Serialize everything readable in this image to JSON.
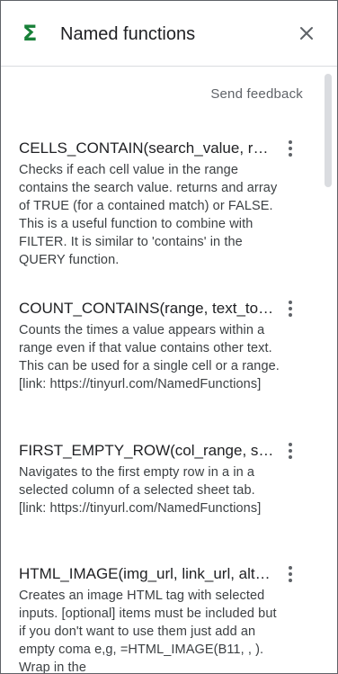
{
  "panel": {
    "title": "Named functions",
    "icon": "sigma-icon",
    "accent_color": "#188038"
  },
  "feedback_label": "Send feedback",
  "functions": [
    {
      "name": "CELLS_CONTAIN(search_value, range)",
      "description": "Checks if each cell value in the range contains the search value. returns and array of TRUE (for a contained match) or FALSE. This is a useful function to combine with FILTER. It is similar to 'contains' in the QUERY function."
    },
    {
      "name": "COUNT_CONTAINS(range, text_to_find)",
      "description": "Counts the times a value appears within a range even if that value contains other text. This can be used for a single cell or a range. [link: https://tinyurl.com/NamedFunctions]"
    },
    {
      "name": "FIRST_EMPTY_ROW(col_range, sheet)",
      "description": "Navigates to the first empty row in a in a selected column of a selected sheet tab. [link: https://tinyurl.com/NamedFunctions]"
    },
    {
      "name": "HTML_IMAGE(img_url, link_url, alt_text)",
      "description": "Creates an image HTML tag with selected inputs. [optional] items must be included but if you don't want to use them just add an empty coma e,g, =HTML_IMAGE(B11, , ). Wrap in the"
    }
  ]
}
